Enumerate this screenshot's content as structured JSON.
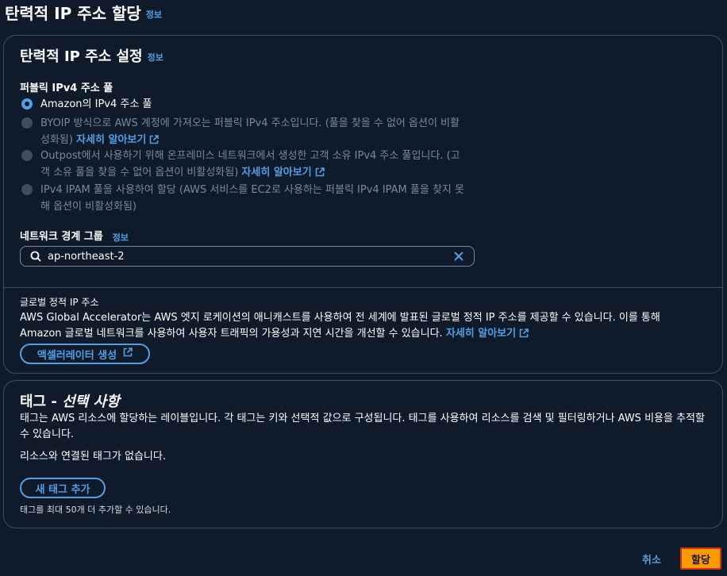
{
  "page": {
    "title": "탄력적 IP 주소 할당",
    "info": "정보"
  },
  "settings": {
    "header": "탄력적 IP 주소 설정",
    "info": "정보",
    "pool_label": "퍼블릭 IPv4 주소 풀",
    "options": [
      {
        "text": "Amazon의 IPv4 주소 풀",
        "checked": true,
        "disabled": false,
        "link": ""
      },
      {
        "text": "BYOIP 방식으로 AWS 계정에 가져오는 퍼블릭 IPv4 주소입니다. (풀을 찾을 수 없어 옵션이 비활성화됨)",
        "checked": false,
        "disabled": true,
        "link": "자세히 알아보기"
      },
      {
        "text": "Outpost에서 사용하기 위해 온프레미스 네트워크에서 생성한 고객 소유 IPv4 주소 풀입니다. (고객 소유 풀을 찾을 수 없어 옵션이 비활성화됨)",
        "checked": false,
        "disabled": true,
        "link": "자세히 알아보기"
      },
      {
        "text": "IPv4 IPAM 풀을 사용하여 할당 (AWS 서비스를 EC2로 사용하는 퍼블릭 IPv4 IPAM 풀을 찾지 못해 옵션이 비활성화됨)",
        "checked": false,
        "disabled": true,
        "link": ""
      }
    ],
    "network_border_label": "네트워크 경계 그룹",
    "network_border_info": "정보",
    "network_border_value": "ap-northeast-2",
    "global_ip_label": "글로벌 정적 IP 주소",
    "global_ip_desc": "AWS Global Accelerator는 AWS 엣지 로케이션의 애니캐스트를 사용하여 전 세계에 발표된 글로벌 정적 IP 주소를 제공할 수 있습니다. 이를 통해 Amazon 글로벌 네트워크를 사용하여 사용자 트래픽의 가용성과 지연 시간을 개선할 수 있습니다.",
    "global_ip_link": "자세히 알아보기",
    "create_accelerator": "액셀러레이터 생성"
  },
  "tags": {
    "header_main": "태그 - ",
    "header_optional": "선택 사항",
    "desc": "태그는 AWS 리소스에 할당하는 레이블입니다. 각 태그는 키와 선택적 값으로 구성됩니다. 태그를 사용하여 리소스를 검색 및 필터링하거나 AWS 비용을 추적할 수 있습니다.",
    "empty": "리소스와 연결된 태그가 없습니다.",
    "add_button": "새 태그 추가",
    "limit": "태그를 최대 50개 더 추가할 수 있습니다."
  },
  "footer": {
    "cancel": "취소",
    "assign": "할당"
  },
  "colors": {
    "background": "#0f1b2a",
    "link": "#539fe5",
    "primary": "#ff9900",
    "border": "#414d5c",
    "highlight": "#d13212"
  },
  "icons": [
    "external-link-icon",
    "search-icon",
    "close-icon",
    "radio-icon"
  ]
}
